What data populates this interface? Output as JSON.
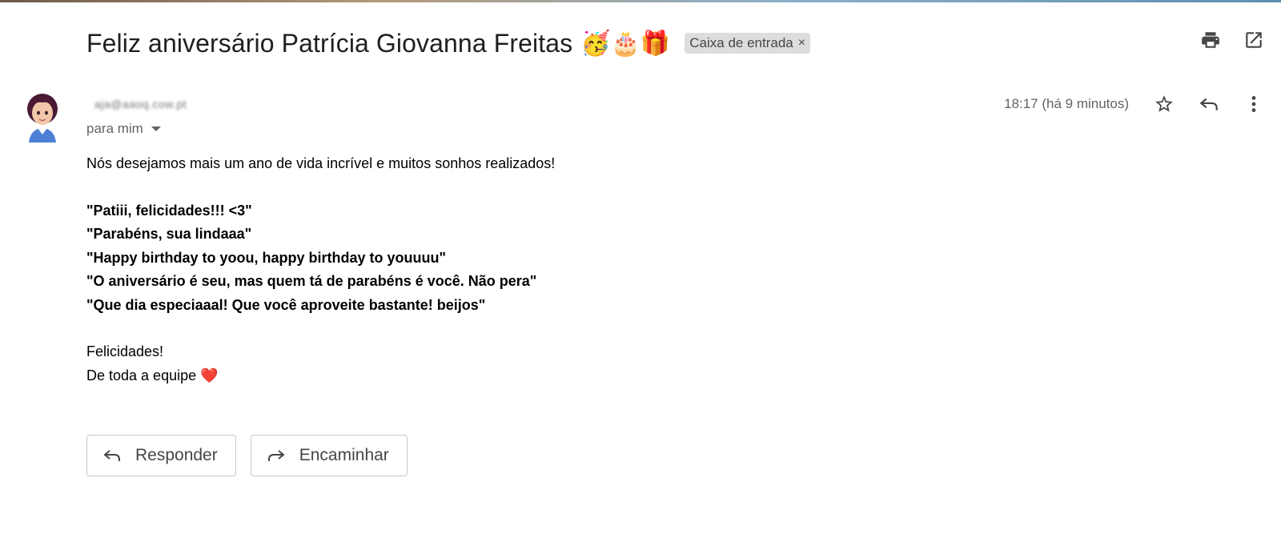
{
  "email": {
    "subject": "Feliz aniversário Patrícia Giovanna Freitas",
    "subject_emoji": "🥳🎂🎁",
    "label": "Caixa de entrada",
    "label_remove": "×",
    "sender": "aja@aaoq.cow.pt",
    "recipient": "para mim",
    "timestamp": "18:17 (há 9 minutos)",
    "body": {
      "intro": "Nós desejamos mais um ano de vida incrível e muitos sonhos realizados!",
      "quotes": [
        "\"Patiii, felicidades!!! <3\"",
        "\"Parabéns, sua lindaaa\"",
        "\"Happy birthday to yoou, happy birthday to youuuu\"",
        "\"O aniversário é seu, mas quem tá de parabéns é você. Não pera\"",
        "\"Que dia especiaaal! Que você aproveite bastante! beijos\""
      ],
      "closing": "Felicidades!",
      "signature": "De toda a equipe",
      "signature_emoji": "❤️"
    }
  },
  "actions": {
    "reply_label": "Responder",
    "forward_label": "Encaminhar"
  },
  "icons": {
    "print": "print-icon",
    "open_new_window": "open-in-new-window-icon",
    "star": "star-icon",
    "reply": "reply-icon",
    "more": "more-vert-icon",
    "forward": "forward-icon"
  },
  "colors": {
    "text": "#202124",
    "muted": "#5f6368",
    "chip_bg": "#dddddd",
    "heart": "#e0262b"
  }
}
